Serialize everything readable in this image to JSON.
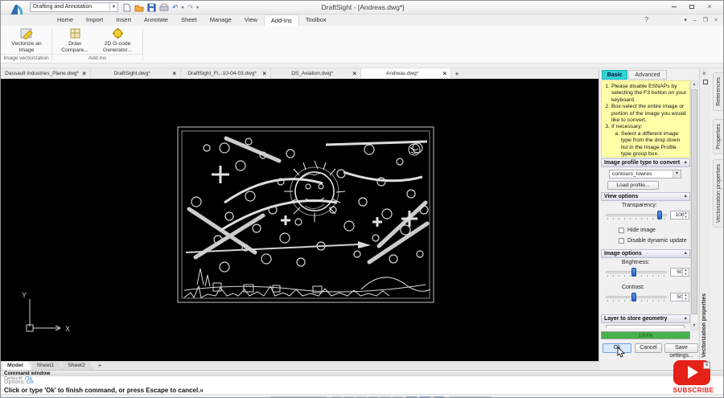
{
  "window": {
    "title": "DraftSight - [Andreas.dwg*]",
    "workspace": "Drafting and Annotation",
    "help": "?"
  },
  "menu_tabs": [
    {
      "label": "Home"
    },
    {
      "label": "Import"
    },
    {
      "label": "Insert"
    },
    {
      "label": "Annotate"
    },
    {
      "label": "Sheet"
    },
    {
      "label": "Manage"
    },
    {
      "label": "View"
    },
    {
      "label": "Add-Ins"
    },
    {
      "label": "Toolbox"
    }
  ],
  "ribbon": {
    "vectorize": "Vectorize an Image",
    "draw_compare": "Draw Compare...",
    "gcode": "2D G-code Generator...",
    "group_image": "Image vectorization",
    "group_addins": "Add-Ins"
  },
  "document_tabs": [
    {
      "label": "Dassault Industries_Plane.dwg*"
    },
    {
      "label": "DraftSight.dwg*"
    },
    {
      "label": "DraftSight_Fi...10-04-03.dwg*"
    },
    {
      "label": "DS_Aviation.dwg*"
    },
    {
      "label": "Andreas.dwg*"
    }
  ],
  "new_tab_button": "+",
  "ucs": {
    "x": "X",
    "y": "Y"
  },
  "panel": {
    "tab_basic": "Basic",
    "tab_advanced": "Advanced",
    "instructions": [
      {
        "num": "1.",
        "text": "Please disable ESNAPs by selecting the F3 button on your keyboard."
      },
      {
        "num": "2.",
        "text": "Box-select the entire image or portion of the image you would like to convert."
      },
      {
        "num": "3.",
        "text": "If necessary:"
      },
      {
        "num": "a.",
        "text": "Select a different image type from the drop down list in the Image Profile type group box."
      }
    ],
    "profile_header": "Image profile type to convert",
    "profile_value": "contours_lowres",
    "load_profile": "Load profile...",
    "view_header": "View options",
    "transparency_label": "Transparency:",
    "transparency_value": "100",
    "hide_image": "Hide image",
    "disable_dynamic": "Disable dynamic update",
    "image_header": "Image options",
    "brightness_label": "Brightness:",
    "brightness_value": "50",
    "contrast_label": "Contrast:",
    "contrast_value": "50",
    "layer_header": "Layer to store geometry",
    "progress": "100%",
    "ok": "Ok",
    "cancel": "Cancel",
    "save_settings": "Save settings..."
  },
  "side_tabs": [
    {
      "label": "References"
    },
    {
      "label": "Properties"
    },
    {
      "label": "Vectorization properties"
    }
  ],
  "panel_vertical_title": "Vectorization properties",
  "sheet_tabs": [
    {
      "label": "Model"
    },
    {
      "label": "Sheet1"
    },
    {
      "label": "Sheet2"
    }
  ],
  "sheet_add": "+",
  "command": {
    "title": "Command window",
    "default_label": "Default:",
    "default_value": "Ok",
    "options_label": "Options:",
    "options_value": "Ok",
    "prompt": "Click or type 'Ok' to finish command, or press Escape to cancel.»"
  },
  "subscribe": "SUBSCRIBE",
  "colors": {
    "basic_tab": "#2fd5d5",
    "instruction_bg": "#ffffa8",
    "slider_thumb": "#2f6fd4",
    "progress_green": "#46b24a",
    "subscribe_red": "#e62117",
    "link_blue": "#4f8fd0"
  }
}
